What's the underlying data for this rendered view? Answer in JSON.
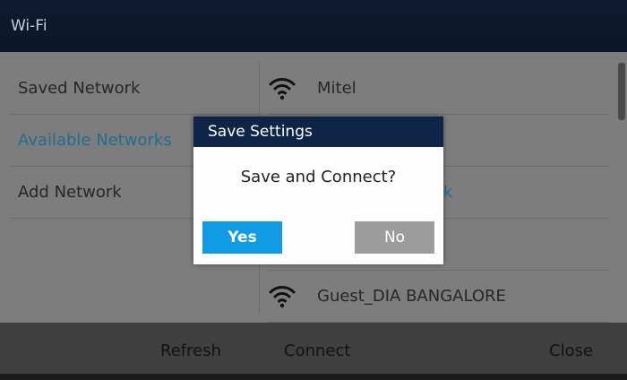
{
  "window": {
    "title": "Wi-Fi"
  },
  "left_menu": {
    "items": [
      {
        "label": "Saved Network",
        "selected": false
      },
      {
        "label": "Available Networks",
        "selected": true
      },
      {
        "label": "Add Network",
        "selected": false
      }
    ]
  },
  "networks": {
    "rows": [
      {
        "name": "Mitel",
        "icon": "wifi-icon"
      },
      {
        "name": "",
        "icon": ""
      },
      {
        "name": "",
        "fragment": "k",
        "icon": ""
      },
      {
        "name": "",
        "icon": ""
      },
      {
        "name": "Guest_DIA BANGALORE",
        "icon": "wifi-icon"
      }
    ]
  },
  "dialog": {
    "title": "Save Settings",
    "message": "Save and Connect?",
    "yes_label": "Yes",
    "no_label": "No"
  },
  "softkeys": {
    "refresh": "Refresh",
    "connect": "Connect",
    "close": "Close"
  },
  "colors": {
    "title_bar": "#0e1b30",
    "dialog_title": "#0f2547",
    "accent": "#109be4",
    "selected_text": "#1f6d93"
  }
}
